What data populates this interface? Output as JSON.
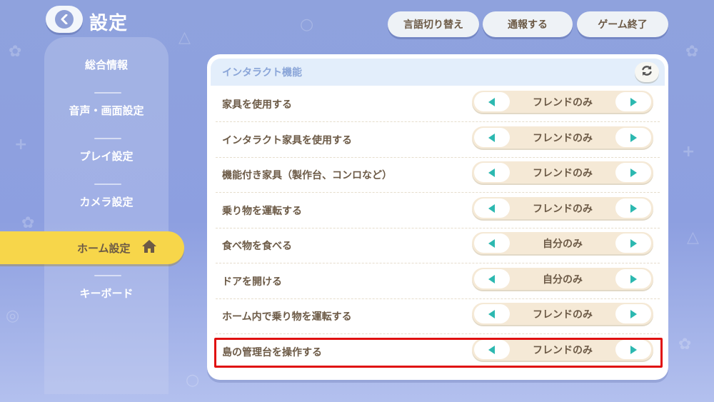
{
  "header": {
    "title": "設定",
    "buttons": {
      "language": "言語切り替え",
      "report": "通報する",
      "quit": "ゲーム終了"
    }
  },
  "sidebar": {
    "items": [
      {
        "label": "総合情報"
      },
      {
        "label": "音声・画面設定"
      },
      {
        "label": "プレイ設定"
      },
      {
        "label": "カメラ設定"
      },
      {
        "label": "ホーム設定",
        "icon": "home-icon",
        "active": true
      },
      {
        "label": "キーボード"
      }
    ]
  },
  "main": {
    "section_title": "インタラクト機能",
    "reset_icon": "refresh-icon",
    "rows": [
      {
        "label": "家具を使用する",
        "value": "フレンドのみ"
      },
      {
        "label": "インタラクト家具を使用する",
        "value": "フレンドのみ"
      },
      {
        "label": "機能付き家具（製作台、コンロなど）",
        "value": "フレンドのみ"
      },
      {
        "label": "乗り物を運転する",
        "value": "フレンドのみ"
      },
      {
        "label": "食べ物を食べる",
        "value": "自分のみ"
      },
      {
        "label": "ドアを開ける",
        "value": "自分のみ"
      },
      {
        "label": "ホーム内で乗り物を運転する",
        "value": "フレンドのみ"
      },
      {
        "label": "島の管理台を操作する",
        "value": "フレンドのみ",
        "highlighted": true
      }
    ]
  },
  "colors": {
    "accent_yellow": "#f7d64a",
    "arrow_teal": "#2cb8b0",
    "highlight_red": "#e01010",
    "section_header_bg": "#e3eefb",
    "selector_bg": "#f5e9d6"
  }
}
